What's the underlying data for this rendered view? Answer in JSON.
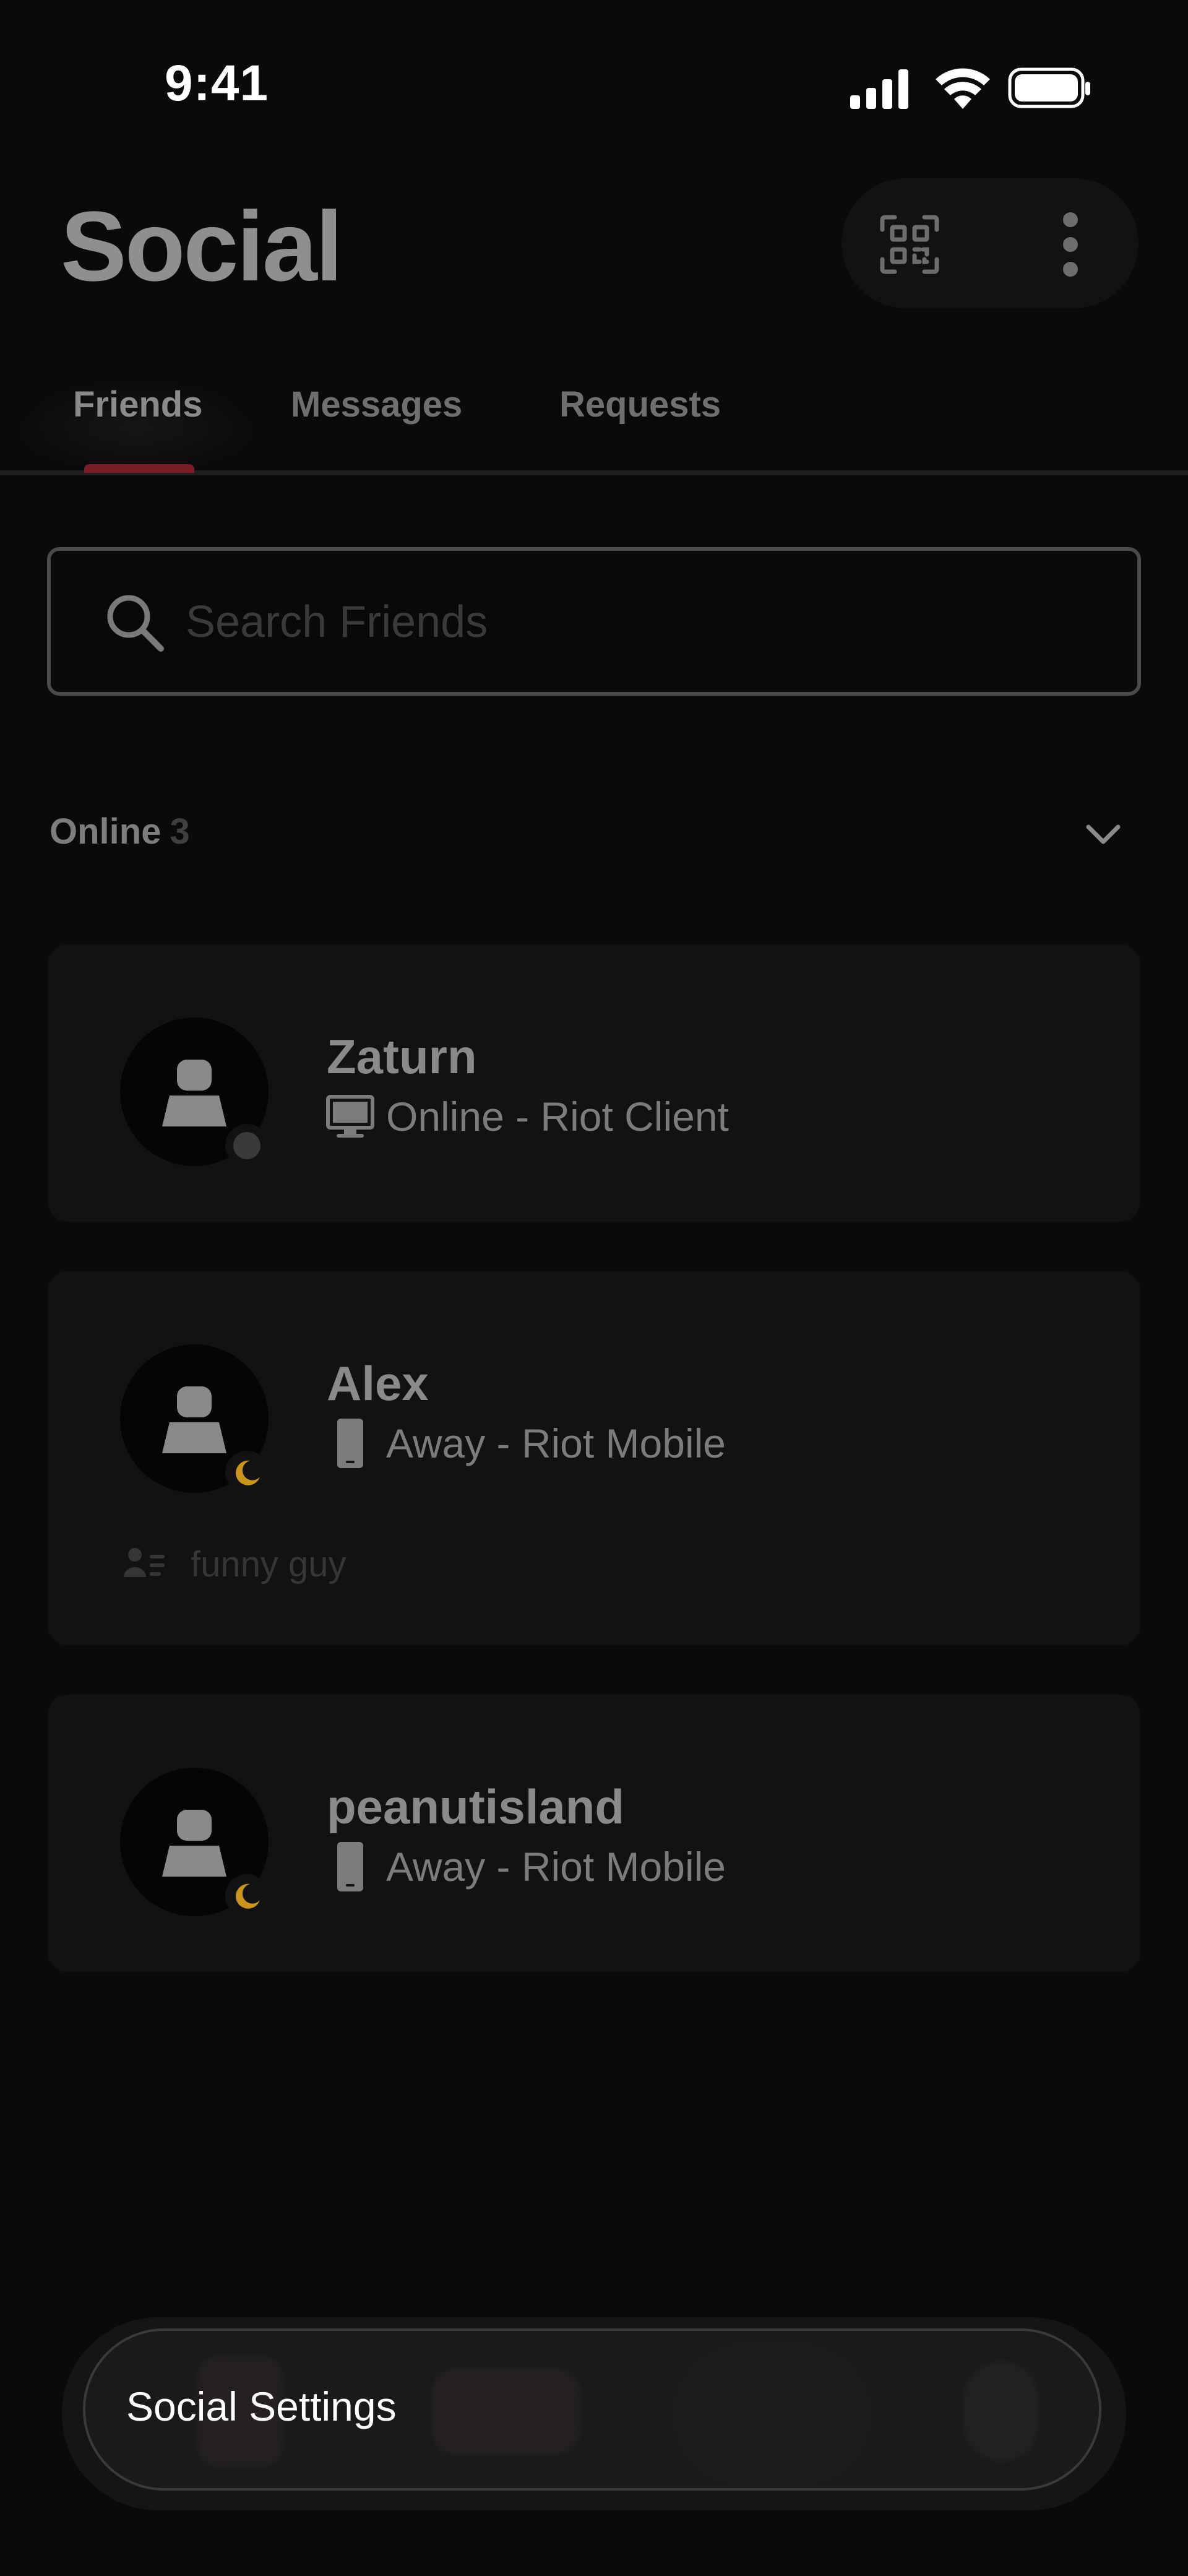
{
  "status_bar": {
    "time": "9:41"
  },
  "header": {
    "title": "Social"
  },
  "tabs": [
    {
      "label": "Friends",
      "active": true
    },
    {
      "label": "Messages",
      "active": false
    },
    {
      "label": "Requests",
      "active": false
    }
  ],
  "search": {
    "placeholder": "Search Friends",
    "value": ""
  },
  "section": {
    "title": "Online",
    "count": "3"
  },
  "friends": [
    {
      "name": "Zaturn",
      "status": "Online - Riot Client",
      "status_icon": "monitor-icon",
      "presence": "online"
    },
    {
      "name": "Alex",
      "status": "Away - Riot Mobile",
      "status_icon": "phone-icon",
      "presence": "away",
      "note": "funny guy"
    },
    {
      "name": "peanutisland",
      "status": "Away - Riot Mobile",
      "status_icon": "phone-icon",
      "presence": "away"
    }
  ],
  "bottom": {
    "settings_label": "Social Settings"
  },
  "colors": {
    "background": "#0a0a0a",
    "card": "#121212",
    "tab_indicator": "#7a1e25",
    "away": "#c9961a",
    "online": "#3a3a3a"
  }
}
